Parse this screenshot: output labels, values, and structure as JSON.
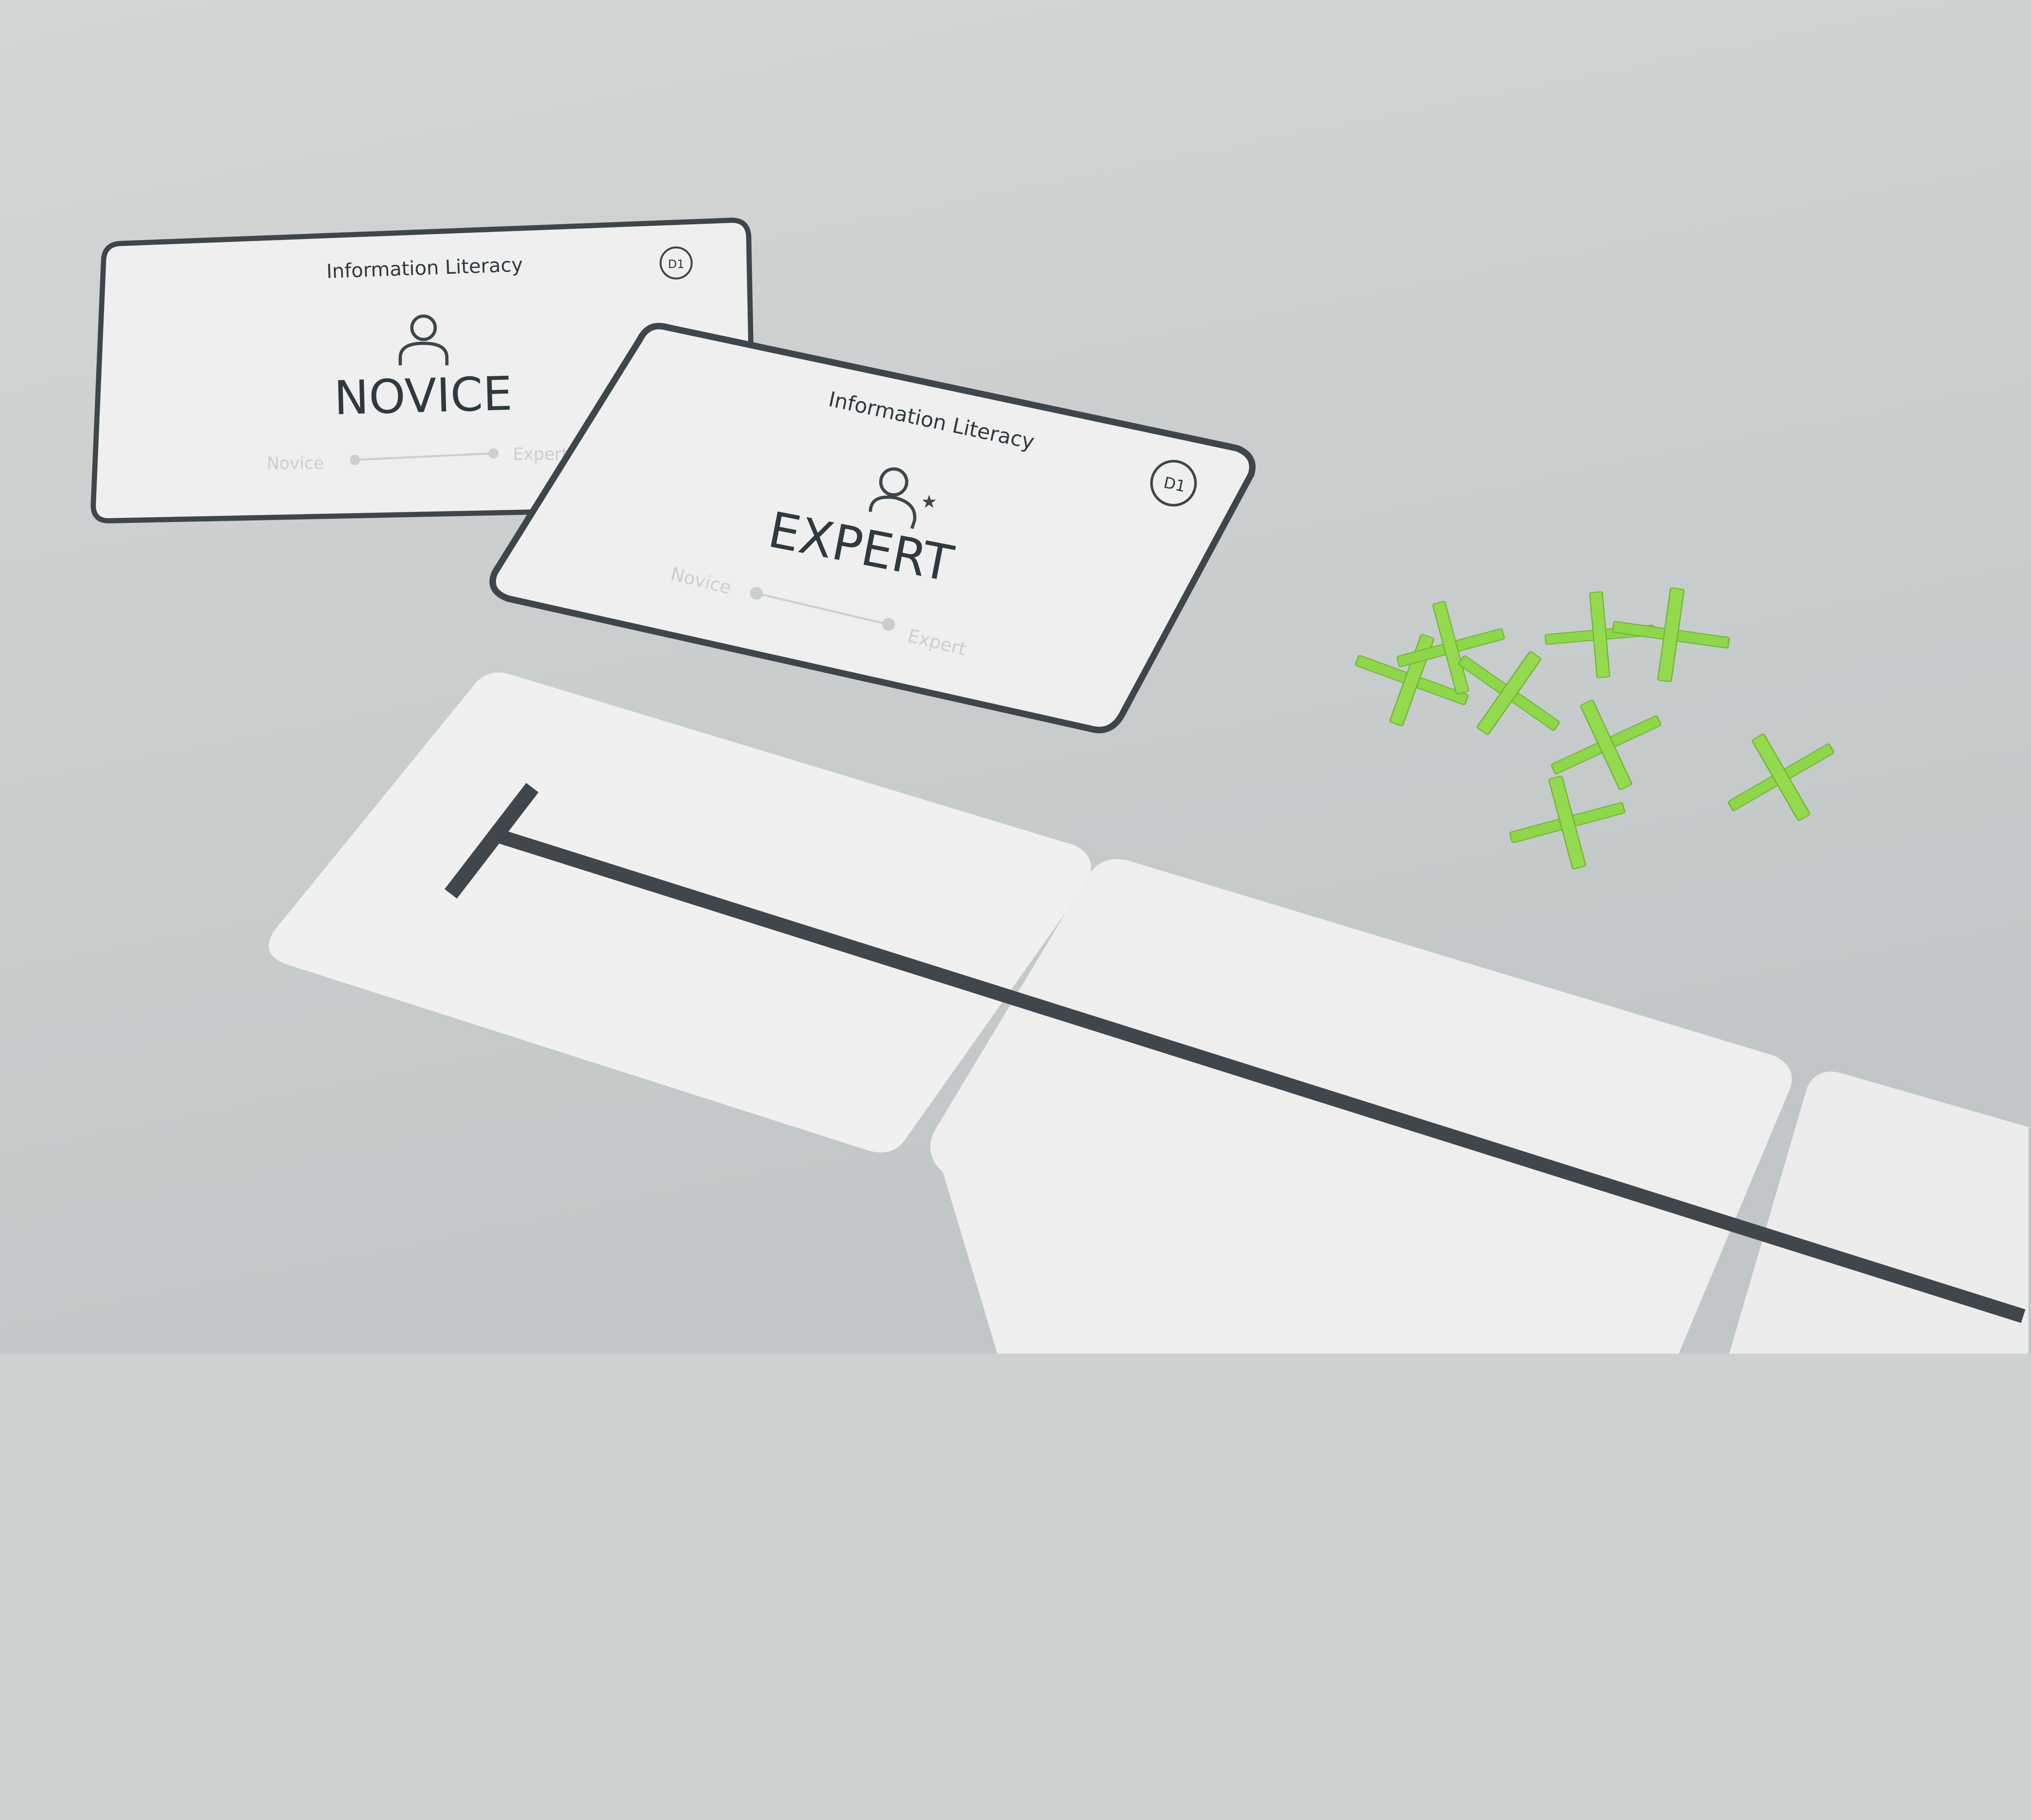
{
  "colors": {
    "background": "#cdd1d1",
    "card": "#efefef",
    "border": "#3d464b",
    "line": "#3f474c",
    "crosses": "#8ed64a"
  },
  "novice_card": {
    "category": "Information Literacy",
    "code": "D1",
    "level": "NOVICE",
    "scale_start": "Novice",
    "scale_end": "Expert",
    "icon": "person-icon"
  },
  "expert_card": {
    "category": "Information Literacy",
    "code": "D1",
    "level": "EXPERT",
    "scale_start": "Novice",
    "scale_end": "Expert",
    "icon": "person-star-icon"
  }
}
